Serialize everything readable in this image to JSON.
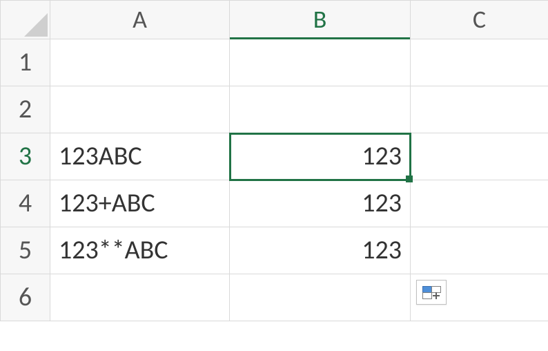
{
  "columns": {
    "a": "A",
    "b": "B",
    "c": "C"
  },
  "rows": {
    "r1": "1",
    "r2": "2",
    "r3": "3",
    "r4": "4",
    "r5": "5",
    "r6": "6"
  },
  "cells": {
    "a3": "123ABC",
    "a4": "123+ABC",
    "a5": "123**ABC",
    "b3": "123",
    "b4": "123",
    "b5": "123"
  },
  "selection": {
    "active_cell": "B3",
    "active_row": "3",
    "active_col": "B"
  },
  "colors": {
    "accent": "#217346",
    "grid_line": "#d9d9d9",
    "header_bg": "#f7f7f7"
  }
}
